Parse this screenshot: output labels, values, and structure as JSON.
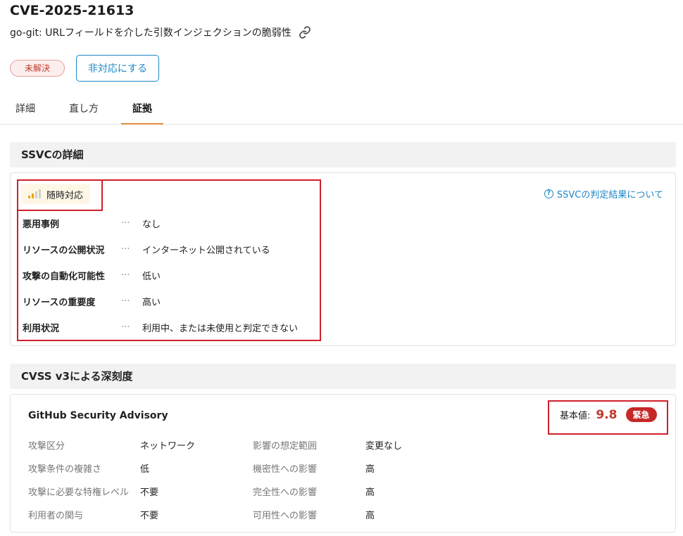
{
  "header": {
    "cve_id": "CVE-2025-21613",
    "description": "go-git: URLフィールドを介した引数インジェクションの脆弱性",
    "status_badge": "未解決",
    "ignore_button": "非対応にする"
  },
  "tabs": [
    {
      "label": "詳細",
      "active": false
    },
    {
      "label": "直し方",
      "active": false
    },
    {
      "label": "証拠",
      "active": true
    }
  ],
  "ssvc": {
    "section_title": "SSVCの詳細",
    "decision": "随時対応",
    "about_link": "SSVCの判定結果について",
    "separator": "···",
    "rows": [
      {
        "label": "悪用事例",
        "value": "なし"
      },
      {
        "label": "リソースの公開状況",
        "value": "インターネット公開されている"
      },
      {
        "label": "攻撃の自動化可能性",
        "value": "低い"
      },
      {
        "label": "リソースの重要度",
        "value": "高い"
      },
      {
        "label": "利用状況",
        "value": "利用中、または未使用と判定できない"
      }
    ]
  },
  "cvss": {
    "section_title": "CVSS v3による深刻度",
    "source": "GitHub Security Advisory",
    "score_label": "基本値:",
    "score": "9.8",
    "severity": "緊急",
    "left_metrics": [
      {
        "label": "攻撃区分",
        "value": "ネットワーク"
      },
      {
        "label": "攻撃条件の複雑さ",
        "value": "低"
      },
      {
        "label": "攻撃に必要な特権レベル",
        "value": "不要"
      },
      {
        "label": "利用者の関与",
        "value": "不要"
      }
    ],
    "right_metrics": [
      {
        "label": "影響の想定範囲",
        "value": "変更なし"
      },
      {
        "label": "機密性への影響",
        "value": "高"
      },
      {
        "label": "完全性への影響",
        "value": "高"
      },
      {
        "label": "可用性への影響",
        "value": "高"
      }
    ]
  },
  "colors": {
    "accent_blue": "#1e88c7",
    "tab_underline": "#e08a3c",
    "critical_red": "#c62828",
    "highlight_box": "#d0202a"
  }
}
